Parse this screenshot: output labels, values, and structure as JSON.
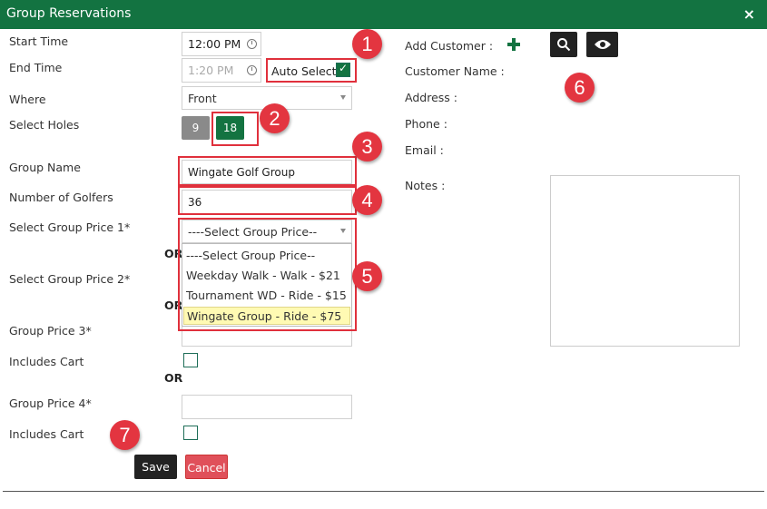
{
  "window": {
    "title": "Group Reservations",
    "close_label": "×"
  },
  "form": {
    "start_time_label": "Start Time",
    "start_time_value": "12:00 PM",
    "end_time_label": "End Time",
    "end_time_value": "1:20 PM",
    "auto_select_label": "Auto Select",
    "auto_select_checked": true,
    "where_label": "Where",
    "where_value": "Front",
    "select_holes_label": "Select Holes",
    "holes": [
      "9",
      "18"
    ],
    "holes_selected": "18",
    "group_name_label": "Group Name",
    "group_name_value": "Wingate Golf Group",
    "num_golfers_label": "Number of Golfers",
    "num_golfers_value": "36",
    "group_price_1_label": "Select Group Price 1*",
    "group_price_1_value": "----Select Group Price--",
    "or_label": "OR",
    "group_price_2_label": "Select Group Price 2*",
    "group_price_3_label": "Group Price 3*",
    "includes_cart_label": "Includes Cart",
    "group_price_4_label": "Group Price 4*"
  },
  "price_options": [
    "----Select Group Price--",
    "Weekday Walk - Walk - $21",
    "Tournament WD - Ride - $15",
    "Wingate Group - Ride - $75"
  ],
  "customer": {
    "add_customer_label": "Add Customer :",
    "customer_name_label": "Customer Name :",
    "address_label": "Address :",
    "phone_label": "Phone :",
    "email_label": "Email :",
    "notes_label": "Notes :"
  },
  "actions": {
    "save_label": "Save",
    "cancel_label": "Cancel"
  },
  "callouts": [
    "1",
    "2",
    "3",
    "4",
    "5",
    "6",
    "7"
  ],
  "colors": {
    "header": "#137341",
    "accent": "#137341",
    "callout": "#e33540",
    "cancel": "#e0505a",
    "save": "#222222"
  },
  "icons": [
    "close-icon",
    "clock-icon",
    "checkmark-icon",
    "chevron-down-icon",
    "plus-icon",
    "search-icon",
    "eye-icon"
  ]
}
